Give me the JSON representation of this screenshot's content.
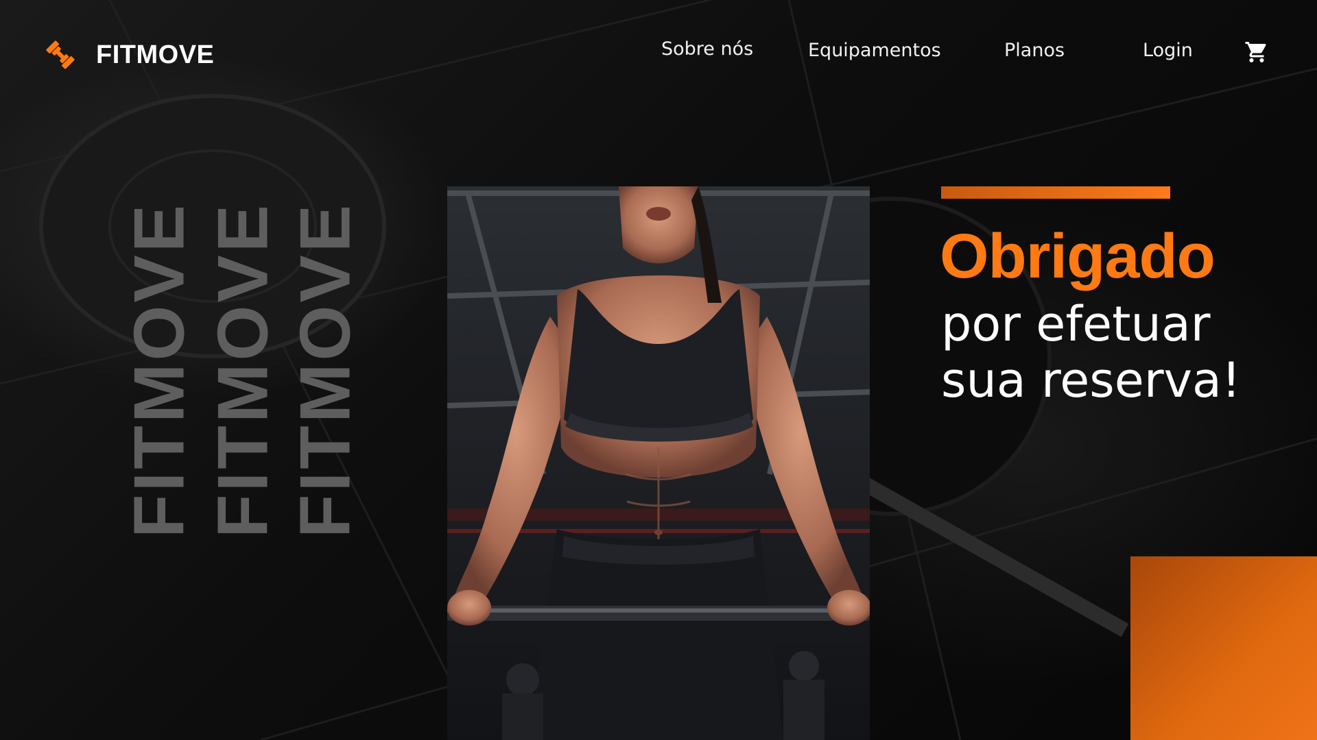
{
  "brand": {
    "name": "FITMOVE",
    "logo_icon": "dumbbell-icon",
    "accent_color": "#ff7a12"
  },
  "nav": {
    "items": [
      {
        "label": "Sobre nós"
      },
      {
        "label": "Equipamentos"
      },
      {
        "label": "Planos"
      },
      {
        "label": "Login"
      }
    ],
    "cart_icon": "shopping-cart-icon"
  },
  "decor": {
    "vertical_words": [
      "FITMOVE",
      "FITMOVE",
      "FITMOVE"
    ]
  },
  "hero": {
    "photo": "woman-lifting-barbell-photo"
  },
  "message": {
    "title": "Obrigado",
    "line1": "por efetuar",
    "line2": "sua reserva!"
  }
}
